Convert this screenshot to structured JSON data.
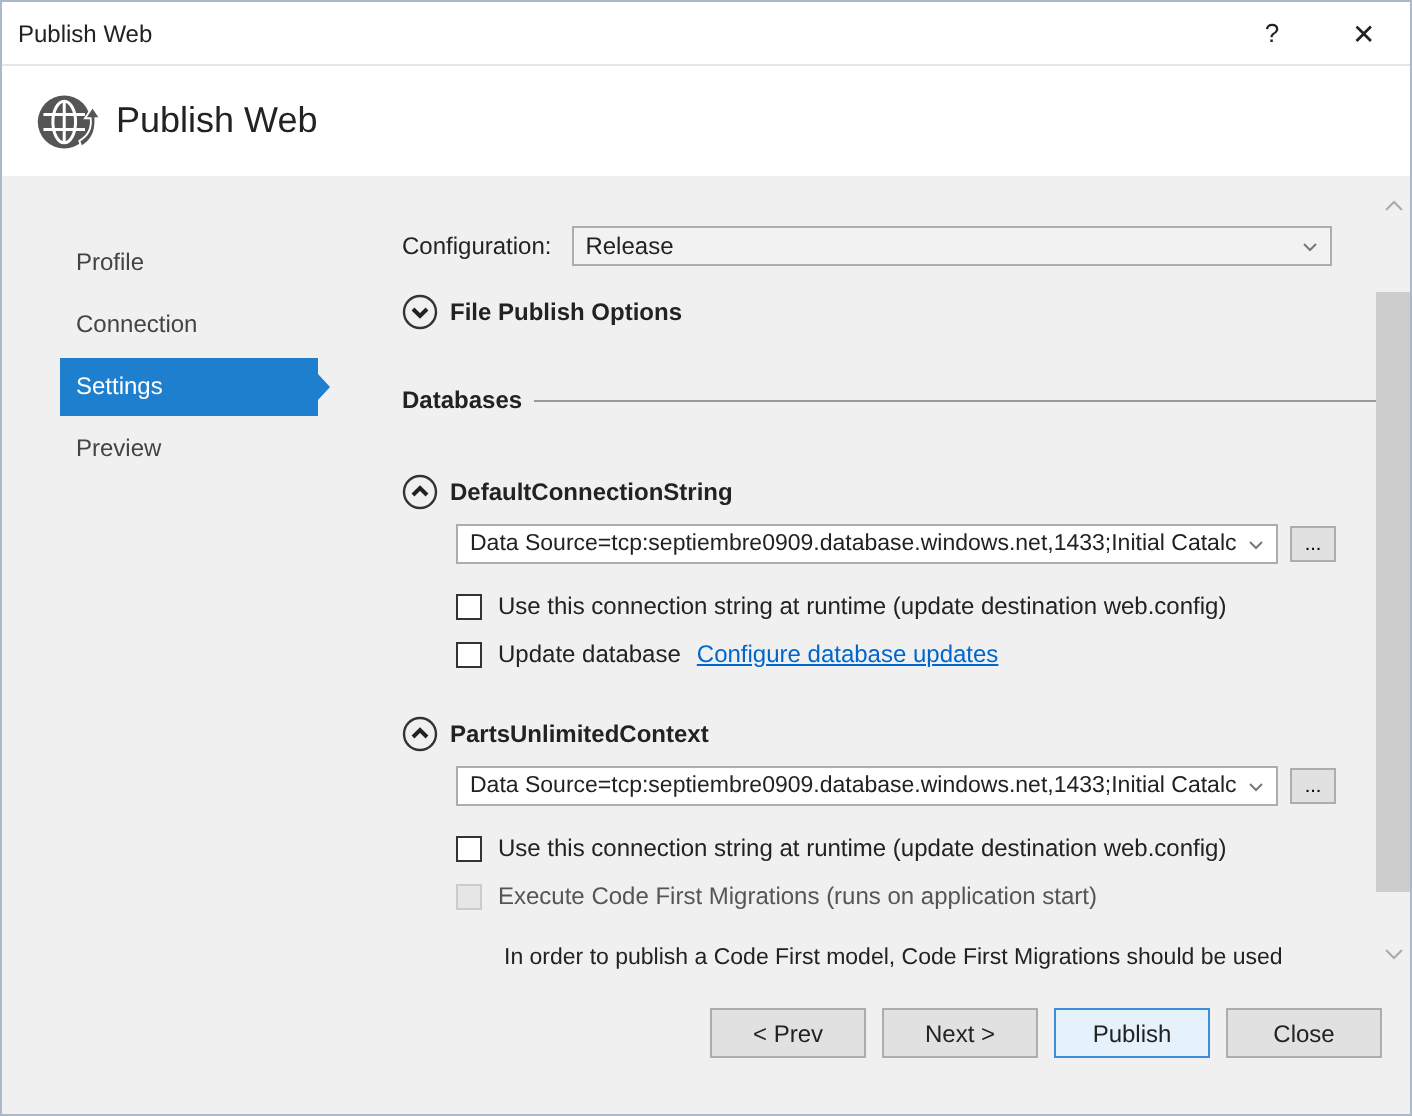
{
  "window": {
    "title": "Publish Web",
    "help": "?",
    "close": "✕"
  },
  "header": {
    "title": "Publish Web"
  },
  "sidebar": {
    "items": [
      {
        "label": "Profile",
        "selected": false
      },
      {
        "label": "Connection",
        "selected": false
      },
      {
        "label": "Settings",
        "selected": true
      },
      {
        "label": "Preview",
        "selected": false
      }
    ]
  },
  "configuration": {
    "label": "Configuration:",
    "value": "Release"
  },
  "file_publish_options": {
    "title": "File Publish Options",
    "expanded": false
  },
  "databases": {
    "title": "Databases",
    "items": [
      {
        "name": "DefaultConnectionString",
        "expanded": true,
        "value": "Data Source=tcp:septiembre0909.database.windows.net,1433;Initial Catalc",
        "browse": "...",
        "options": [
          {
            "kind": "checkbox",
            "label": "Use this connection string at runtime (update destination web.config)",
            "checked": false,
            "disabled": false
          },
          {
            "kind": "checkbox",
            "label": "Update database",
            "checked": false,
            "disabled": false,
            "link": "Configure database updates"
          }
        ]
      },
      {
        "name": "PartsUnlimitedContext",
        "expanded": true,
        "value": "Data Source=tcp:septiembre0909.database.windows.net,1433;Initial Catalc",
        "browse": "...",
        "options": [
          {
            "kind": "checkbox",
            "label": "Use this connection string at runtime (update destination web.config)",
            "checked": false,
            "disabled": false
          },
          {
            "kind": "checkbox",
            "label": "Execute Code First Migrations (runs on application start)",
            "checked": false,
            "disabled": true
          },
          {
            "kind": "note",
            "label": "In order to publish a Code First model, Code First Migrations should be used"
          }
        ]
      }
    ]
  },
  "buttons": [
    {
      "label": "< Prev",
      "default": false
    },
    {
      "label": "Next >",
      "default": false
    },
    {
      "label": "Publish",
      "default": true
    },
    {
      "label": "Close",
      "default": false
    }
  ]
}
